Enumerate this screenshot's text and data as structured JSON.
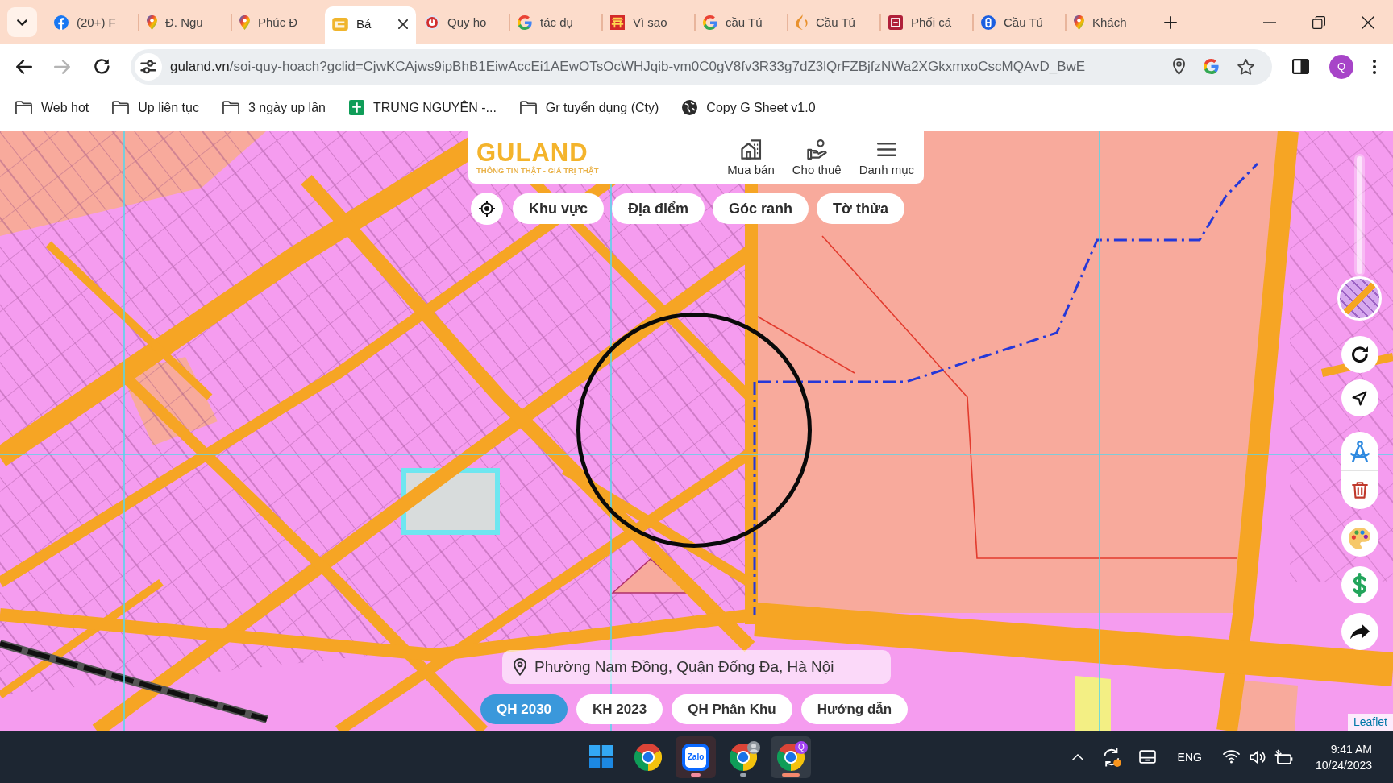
{
  "browser": {
    "tabs": [
      {
        "title": "(20+) F",
        "kind": "f",
        "selected": false
      },
      {
        "title": "Đ. Ngu",
        "kind": "pin",
        "selected": false
      },
      {
        "title": "Phúc Đ",
        "kind": "pin",
        "selected": false
      },
      {
        "title": "Bá",
        "kind": "tile",
        "selected": true
      },
      {
        "title": "Quy ho",
        "kind": "ring",
        "selected": false
      },
      {
        "title": "tác dụ",
        "kind": "g",
        "selected": false
      },
      {
        "title": "Vì sao",
        "kind": "gate",
        "selected": false
      },
      {
        "title": "cầu Tú",
        "kind": "g",
        "selected": false
      },
      {
        "title": "Cầu Tú",
        "kind": "flame",
        "selected": false
      },
      {
        "title": "Phối cá",
        "kind": "square",
        "selected": false
      },
      {
        "title": "Cầu Tú",
        "kind": "circle",
        "selected": false
      },
      {
        "title": "Khách",
        "kind": "pin",
        "selected": false
      }
    ],
    "forward_enabled": false,
    "address": {
      "host": "guland.vn",
      "path": "/soi-quy-hoach?gclid=CjwKCAjws9ipBhB1EiwAccEi1AEwOTsOcWHJqib-vm0C0gV8fv3R33g7dZ3lQrFZBjfzNWa2XGkxmxoCscMQAvD_BwE"
    },
    "profile": "Q",
    "bookmarks": [
      {
        "label": "Web hot",
        "kind": "folder"
      },
      {
        "label": "Up liên tục",
        "kind": "folder"
      },
      {
        "label": "3 ngày up lần",
        "kind": "folder"
      },
      {
        "label": "TRUNG NGUYÊN -...",
        "kind": "sheet"
      },
      {
        "label": "Gr tuyển dụng (Cty)",
        "kind": "folder"
      },
      {
        "label": "Copy G Sheet v1.0",
        "kind": "globe"
      }
    ]
  },
  "app": {
    "brand": {
      "name": "GULAND",
      "tagline": "THÔNG TIN THẬT - GIÁ TRỊ THẬT"
    },
    "nav": [
      {
        "label": "Mua bán",
        "kind": "building"
      },
      {
        "label": "Cho thuê",
        "kind": "hand"
      },
      {
        "label": "Danh mục",
        "kind": "menu"
      }
    ],
    "search_modes": [
      {
        "label": "Khu vực"
      },
      {
        "label": "Địa điểm"
      },
      {
        "label": "Góc ranh"
      },
      {
        "label": "Tờ thửa"
      }
    ],
    "layer_opacity": {
      "level": 1
    },
    "location": "Phường Nam Đồng, Quận Đống Đa, Hà Nội",
    "plan_buttons": [
      {
        "label": "QH 2030",
        "selected": true
      },
      {
        "label": "KH 2023",
        "selected": false
      },
      {
        "label": "QH Phân Khu",
        "selected": false
      },
      {
        "label": "Hướng dẫn",
        "selected": false
      }
    ],
    "attribution": "Leaflet"
  },
  "taskbar": {
    "apps": [
      {
        "kind": "start",
        "running": false,
        "selected": false,
        "flashing": false
      },
      {
        "kind": "browser",
        "running": false,
        "selected": false,
        "flashing": false,
        "avatar": false
      },
      {
        "kind": "chat",
        "label": "Zalo",
        "running": true,
        "selected": false,
        "flashing": true
      },
      {
        "kind": "browser",
        "running": true,
        "selected": false,
        "flashing": false,
        "avatar": true
      },
      {
        "kind": "browser",
        "running": true,
        "selected": true,
        "flashing": false,
        "avatar": false,
        "badge": "Q"
      }
    ],
    "language": "ENG",
    "time": "9:41 AM",
    "date": "10/24/2023"
  }
}
